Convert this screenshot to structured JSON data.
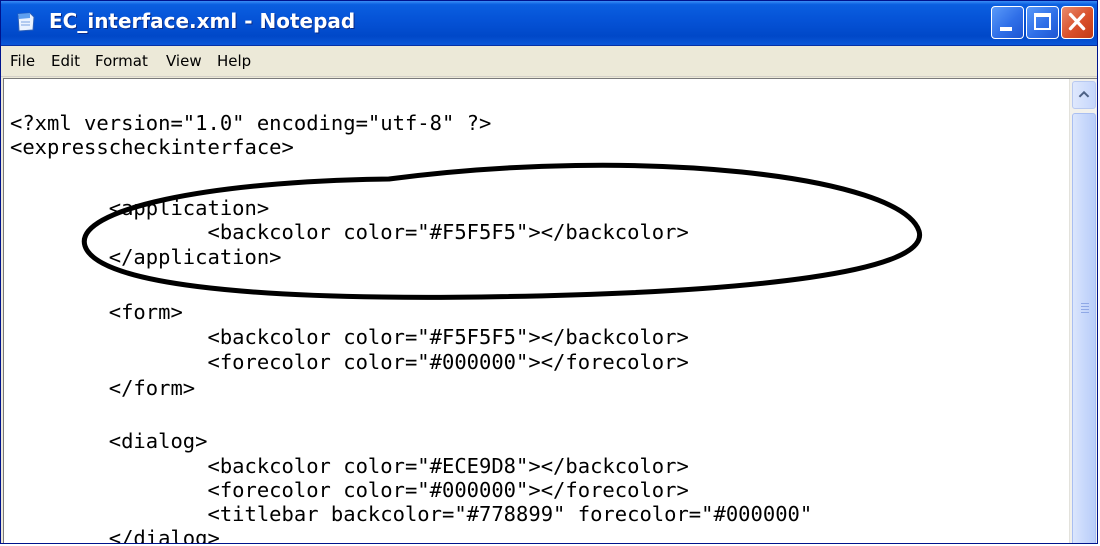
{
  "window": {
    "title": "EC_interface.xml - Notepad",
    "icon": "notepad-icon",
    "controls": [
      "minimize-icon",
      "maximize-icon",
      "close-icon"
    ]
  },
  "menu": {
    "file": "File",
    "edit": "Edit",
    "format": "Format",
    "view": "View",
    "help": "Help"
  },
  "editor": {
    "lines": [
      "<?xml version=\"1.0\" encoding=\"utf-8\" ?>",
      "<expresscheckinterface>",
      "",
      "        <application>",
      "                <backcolor color=\"#F5F5F5\"></backcolor>",
      "        </application>",
      "",
      "        <form>",
      "                <backcolor color=\"#F5F5F5\"></backcolor>",
      "                <forecolor color=\"#000000\"></forecolor>",
      "        </form>",
      "",
      "        <dialog>",
      "                <backcolor color=\"#ECE9D8\"></backcolor>",
      "                <forecolor color=\"#000000\"></forecolor>",
      "                <titlebar backcolor=\"#778899\" forecolor=\"#000000\"",
      "        </dialog>"
    ]
  },
  "colors": {
    "titlebar": "#0552d6",
    "close_button": "#d9502b",
    "menu_background": "#ece9d8",
    "annotation": "#000000"
  }
}
